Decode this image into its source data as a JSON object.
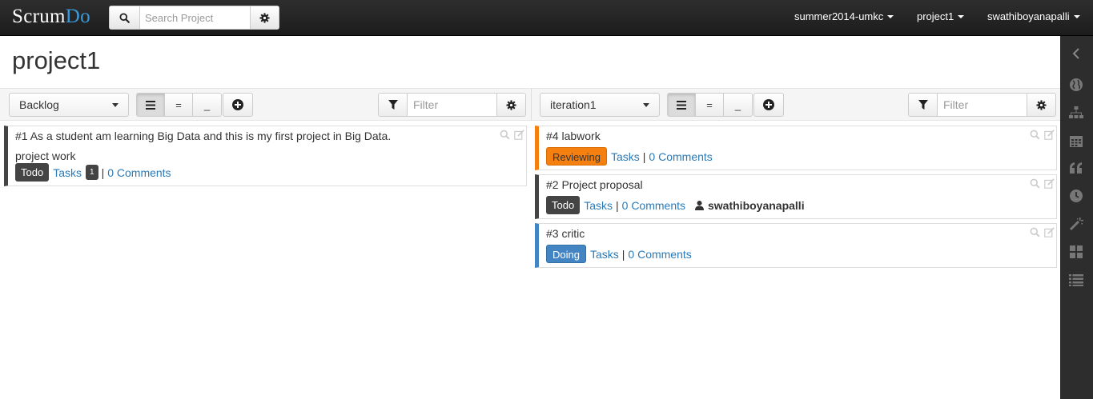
{
  "app": {
    "logo_a": "Scrum",
    "logo_b": "Do"
  },
  "search": {
    "placeholder": "Search Project"
  },
  "nav": {
    "org": "summer2014-umkc",
    "project": "project1",
    "user": "swathiboyanapalli"
  },
  "page": {
    "title": "project1"
  },
  "left_pane": {
    "selector": "Backlog",
    "view_buttons": [
      "≡",
      "=",
      "_"
    ],
    "filter_placeholder": "Filter",
    "cards": [
      {
        "title": "#1  As a student am learning Big Data and this is my first project in Big Data.",
        "description": "project work",
        "status": "Todo",
        "tasks_label": "Tasks",
        "tasks_count": "1",
        "comments": "0 Comments",
        "color": "#444444"
      }
    ]
  },
  "right_pane": {
    "selector": "iteration1",
    "filter_placeholder": "Filter",
    "cards": [
      {
        "title": "#4  labwork",
        "status": "Reviewing",
        "tasks_label": "Tasks",
        "comments": "0 Comments",
        "color": "#f5800f"
      },
      {
        "title": "#2  Project proposal",
        "status": "Todo",
        "tasks_label": "Tasks",
        "comments": "0 Comments",
        "owner": "swathiboyanapalli",
        "color": "#444444"
      },
      {
        "title": "#3  critic",
        "status": "Doing",
        "tasks_label": "Tasks",
        "comments": "0 Comments",
        "color": "#4285c2"
      }
    ]
  },
  "rail_icons": [
    "chevron-left-icon",
    "globe-icon",
    "sitemap-icon",
    "calendar-icon",
    "quote-icon",
    "clock-icon",
    "magic-wand-icon",
    "dashboard-icon",
    "list-icon"
  ]
}
